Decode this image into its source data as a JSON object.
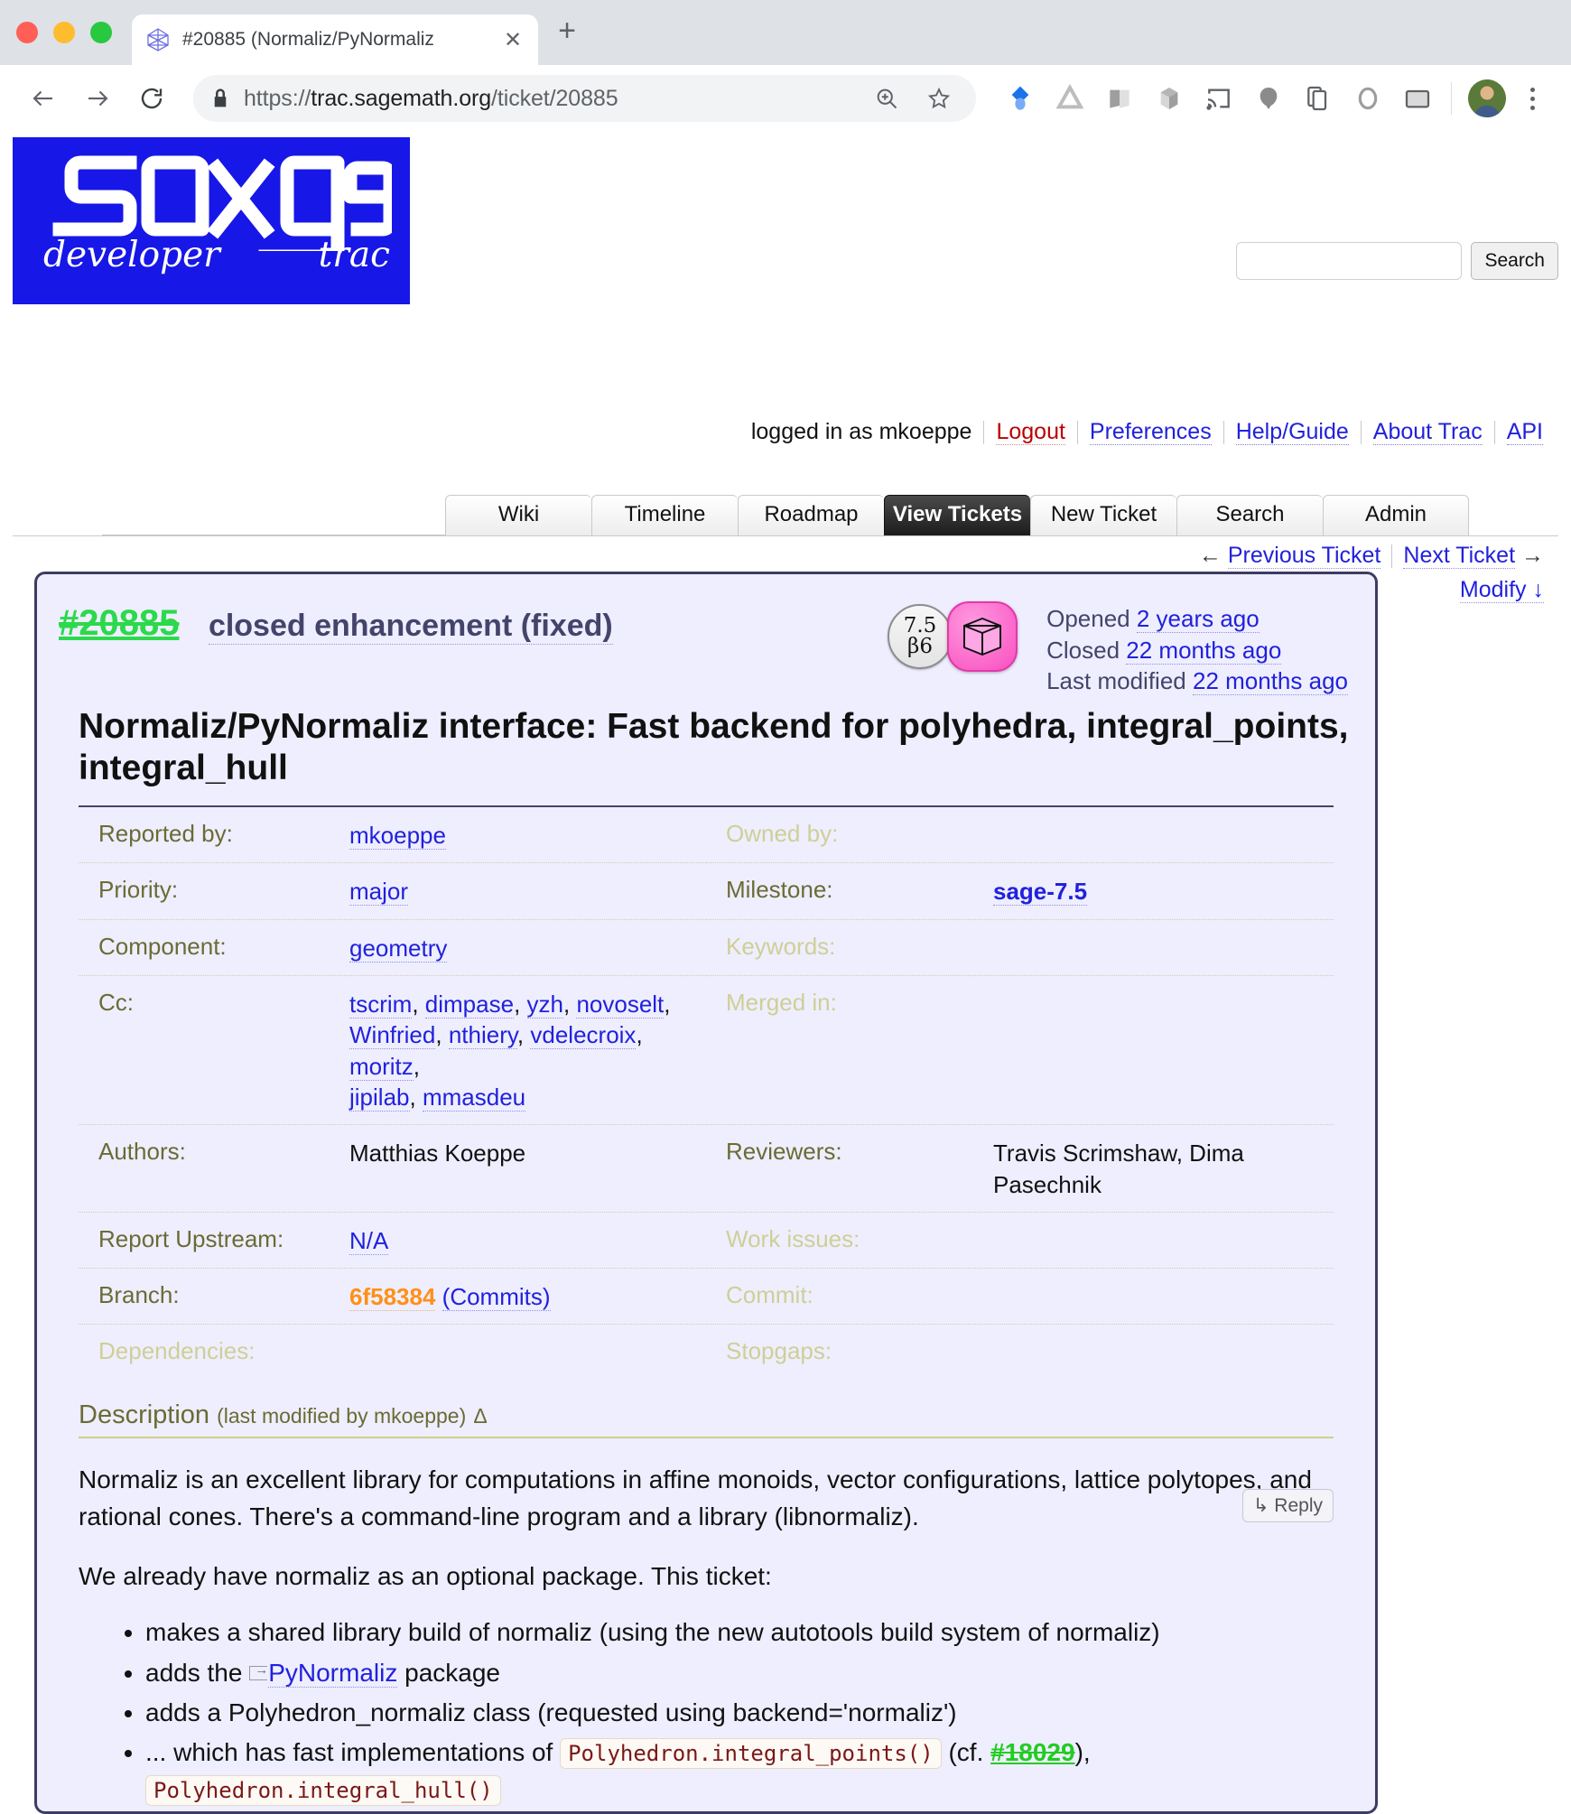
{
  "browser": {
    "tab": {
      "title": "#20885 (Normaliz/PyNormaliz",
      "close_label": "✕",
      "favicon": "polytope-icon"
    },
    "newtab_label": "+",
    "url_scheme": "https://",
    "url_host": "trac.sagemath.org",
    "url_path": "/ticket/20885",
    "back_label": "←",
    "forward_label": "→",
    "reload_label": "⟳",
    "extensions": [
      "diamond-icon",
      "drive-icon",
      "book-icon",
      "cube-icon",
      "cast-icon",
      "balloon-icon",
      "copy-icon",
      "circle-icon",
      "window-icon"
    ]
  },
  "site": {
    "logo_text": "sage",
    "logo_sub_left": "developer",
    "logo_sub_right": "trac"
  },
  "search": {
    "value": "",
    "placeholder": "",
    "button": "Search"
  },
  "metanav": {
    "logged_in": "logged in as mkoeppe",
    "items": [
      {
        "label": "Logout",
        "style": "red"
      },
      {
        "label": "Preferences",
        "style": "blue"
      },
      {
        "label": "Help/Guide",
        "style": "blue"
      },
      {
        "label": "About Trac",
        "style": "blue"
      },
      {
        "label": "API",
        "style": "blue"
      }
    ]
  },
  "mainnav": {
    "tabs": [
      {
        "label": "Wiki",
        "active": false
      },
      {
        "label": "Timeline",
        "active": false
      },
      {
        "label": "Roadmap",
        "active": false
      },
      {
        "label": "View Tickets",
        "active": true
      },
      {
        "label": "New Ticket",
        "active": false
      },
      {
        "label": "Search",
        "active": false
      },
      {
        "label": "Admin",
        "active": false
      }
    ]
  },
  "ctxnav": {
    "prev_arrow": "←",
    "prev": "Previous Ticket",
    "next": "Next Ticket",
    "next_arrow": "→",
    "modify": "Modify ↓"
  },
  "ticket": {
    "id": "#20885",
    "status": "closed enhancement (fixed)",
    "version_badge_line1": "7.5",
    "version_badge_line2": "β6",
    "cube_badge": "polytope-cube-icon",
    "opened_label": "Opened",
    "opened_value": "2 years ago",
    "closed_label": "Closed",
    "closed_value": "22 months ago",
    "modified_label": "Last modified",
    "modified_value": "22 months ago",
    "title": "Normaliz/PyNormaliz interface: Fast backend for polyhedra, integral_points, integral_hull",
    "properties": [
      [
        {
          "label": "Reported by:",
          "value": "mkoeppe",
          "kind": "link"
        },
        {
          "label": "Owned by:",
          "value": "",
          "kind": "empty"
        }
      ],
      [
        {
          "label": "Priority:",
          "value": "major",
          "kind": "link"
        },
        {
          "label": "Milestone:",
          "value": "sage-7.5",
          "kind": "milestone"
        }
      ],
      [
        {
          "label": "Component:",
          "value": "geometry",
          "kind": "link"
        },
        {
          "label": "Keywords:",
          "value": "",
          "kind": "empty"
        }
      ],
      [
        {
          "label": "Cc:",
          "value": "tscrim, dimpase, yzh, novoselt, Winfried, nthiery, vdelecroix, moritz, jipilab, mmasdeu",
          "kind": "cc"
        },
        {
          "label": "Merged in:",
          "value": "",
          "kind": "empty"
        }
      ],
      [
        {
          "label": "Authors:",
          "value": "Matthias Koeppe",
          "kind": "text"
        },
        {
          "label": "Reviewers:",
          "value": "Travis Scrimshaw, Dima Pasechnik",
          "kind": "text"
        }
      ],
      [
        {
          "label": "Report Upstream:",
          "value": "N/A",
          "kind": "link"
        },
        {
          "label": "Work issues:",
          "value": "",
          "kind": "empty"
        }
      ],
      [
        {
          "label": "Branch:",
          "value": "6f58384",
          "extra": "(Commits)",
          "kind": "branch"
        },
        {
          "label": "Commit:",
          "value": "",
          "kind": "empty"
        }
      ],
      [
        {
          "label": "Dependencies:",
          "value": "",
          "kind": "empty"
        },
        {
          "label": "Stopgaps:",
          "value": "",
          "kind": "empty"
        }
      ]
    ],
    "cc_list": [
      "tscrim",
      "dimpase",
      "yzh",
      "novoselt",
      "Winfried",
      "nthiery",
      "vdelecroix",
      "moritz",
      "jipilab",
      "mmasdeu"
    ],
    "description_heading": "Description",
    "description_note": "(last modified by mkoeppe)",
    "description_delta": "Δ",
    "reply_label": "↳ Reply",
    "description_p1": "Normaliz is an excellent library for computations in affine monoids, vector configurations, lattice polytopes, and rational cones. There's a command-line program and a library (libnormaliz).",
    "description_p2": "We already have normaliz as an optional package. This ticket:",
    "bullets": {
      "b1": "makes a shared library build of normaliz (using the new autotools build system of normaliz)",
      "b2_pre": "adds the ",
      "b2_link": "PyNormaliz",
      "b2_post": " package",
      "b3": "adds a Polyhedron_normaliz class (requested using backend='normaliz')",
      "b4_pre": "... which has fast implementations of ",
      "b4_code1": "Polyhedron.integral_points()",
      "b4_mid": " (cf. ",
      "b4_ticket": "#18029",
      "b4_post": "), ",
      "b4_code2": "Polyhedron.integral_hull()"
    }
  },
  "colors": {
    "ticket_bg": "#eeeeff",
    "ticket_border": "#3c3c64",
    "logo_blue": "#1717e8",
    "link_blue": "#2121dd",
    "closed_green": "#22cc22",
    "branch_orange": "#ff9016",
    "code_red": "#7a1818",
    "label_olive": "#6b6b34"
  }
}
